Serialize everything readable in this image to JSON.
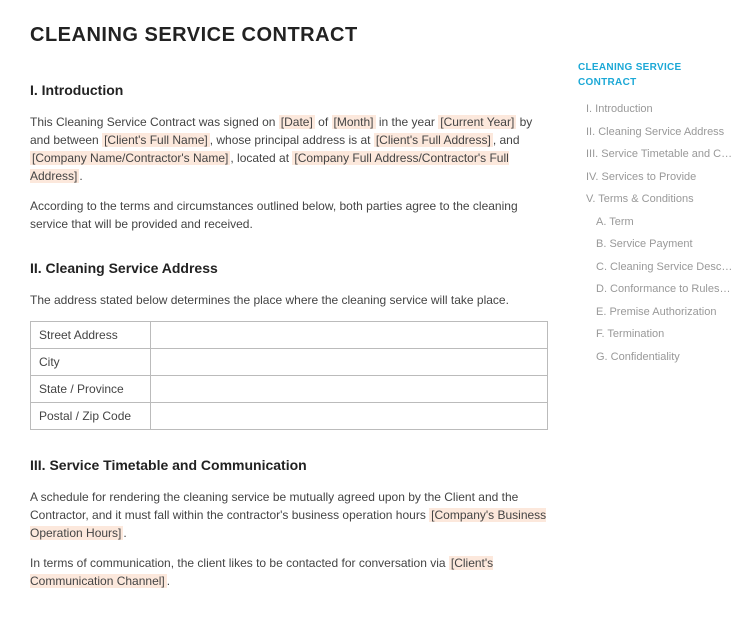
{
  "title": "CLEANING SERVICE CONTRACT",
  "sections": {
    "intro": {
      "heading": "I. Introduction",
      "p1_a": "This Cleaning Service Contract was signed on ",
      "p1_date": "[Date]",
      "p1_b": " of ",
      "p1_month": "[Month]",
      "p1_c": " in the year ",
      "p1_year": "[Current Year]",
      "p1_d": " by and between ",
      "p1_client": "[Client's Full Name]",
      "p1_e": ", whose principal address is at ",
      "p1_clientaddr": "[Client's Full Address]",
      "p1_f": ", and ",
      "p1_company": "[Company Name/Contractor's Name]",
      "p1_g": ", located at ",
      "p1_companyaddr": "[Company Full Address/Contractor's Full Address]",
      "p1_h": ".",
      "p2": "According to the terms and circumstances outlined below, both parties agree to the cleaning service that will be provided and received."
    },
    "address": {
      "heading": "II. Cleaning Service Address",
      "p1": "The address stated below determines the place where the cleaning service will take place.",
      "rows": [
        "Street Address",
        "City",
        "State / Province",
        "Postal / Zip Code"
      ]
    },
    "timetable": {
      "heading": "III. Service Timetable and Communication",
      "p1_a": "A schedule for rendering the cleaning service be mutually agreed upon by the Client and the Contractor, and it must fall within the contractor's business operation hours ",
      "p1_hours": "[Company's Business Operation Hours]",
      "p1_b": ".",
      "p2_a": "In terms of communication, the client likes to be contacted for conversation via ",
      "p2_channel": "[Client's Communication Channel]",
      "p2_b": "."
    }
  },
  "toc": {
    "title": "CLEANING SERVICE CONTRACT",
    "items": [
      {
        "label": "I. Introduction",
        "sub": false
      },
      {
        "label": "II. Cleaning Service Address",
        "sub": false
      },
      {
        "label": "III. Service Timetable and Co...",
        "sub": false
      },
      {
        "label": "IV. Services to Provide",
        "sub": false
      },
      {
        "label": "V. Terms & Conditions",
        "sub": false
      },
      {
        "label": "A. Term",
        "sub": true
      },
      {
        "label": "B. Service Payment",
        "sub": true
      },
      {
        "label": "C. Cleaning Service Descript...",
        "sub": true
      },
      {
        "label": "D. Conformance to Rules & ...",
        "sub": true
      },
      {
        "label": "E. Premise Authorization",
        "sub": true
      },
      {
        "label": "F. Termination",
        "sub": true
      },
      {
        "label": "G. Confidentiality",
        "sub": true
      }
    ]
  }
}
